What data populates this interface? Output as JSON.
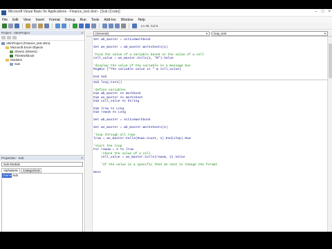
{
  "window": {
    "title": "Microsoft Visual Basic for Applications - Finance_test.xlsm - [Sub (Code)]",
    "controls": [
      "–",
      "□",
      "×"
    ]
  },
  "menu": [
    "File",
    "Edit",
    "View",
    "Insert",
    "Format",
    "Debug",
    "Run",
    "Tools",
    "Add-Ins",
    "Window",
    "Help"
  ],
  "toolbar": {
    "position": "Ln 40, Col 5"
  },
  "project_pane": {
    "title": "Project - VBAProject",
    "close": "×",
    "tree": [
      {
        "label": "VBAProject (Finance_test.xlsm)",
        "indent": 0,
        "kind": "proj"
      },
      {
        "label": "Microsoft Excel Objects",
        "indent": 1,
        "kind": "folder"
      },
      {
        "label": "Sheet1 (Sheet1)",
        "indent": 2,
        "kind": "sheet"
      },
      {
        "label": "ThisWorkbook",
        "indent": 2,
        "kind": "wb"
      },
      {
        "label": "Modules",
        "indent": 1,
        "kind": "folder"
      },
      {
        "label": "Sub",
        "indent": 2,
        "kind": "mod"
      }
    ]
  },
  "properties_pane": {
    "title": "Properties - Sub",
    "close": "×",
    "selected": "Sub Module",
    "tabs": [
      "Alphabetic",
      "Categorized"
    ],
    "rows": [
      {
        "key": "(Name)",
        "value": "Sub"
      }
    ]
  },
  "code_window": {
    "object_select": "(General)",
    "proc_select": "loop_test",
    "lines": [
      {
        "text": "Set wb_master = ActiveWorkbook",
        "kind": "code"
      },
      {
        "text": "",
        "kind": "blank"
      },
      {
        "text": "Set ws_master = wb_master.Worksheets(1)",
        "kind": "code"
      },
      {
        "text": "",
        "kind": "blank"
      },
      {
        "text": "'Find the value of a variable based on the value of a cell",
        "kind": "comment"
      },
      {
        "text": "cell_value = ws_master.Cells(1, \"B\").Value",
        "kind": "code"
      },
      {
        "text": "",
        "kind": "blank"
      },
      {
        "text": "'display the value of the variable in a message box",
        "kind": "comment"
      },
      {
        "text": "MsgBox (\"The variable value is \" & cell_value)",
        "kind": "code"
      },
      {
        "text": "",
        "kind": "blank"
      },
      {
        "text": "End Sub",
        "kind": "code"
      },
      {
        "text": "",
        "kind": "sep"
      },
      {
        "text": "Sub loop_test()",
        "kind": "code"
      },
      {
        "text": "",
        "kind": "blank"
      },
      {
        "text": "'define variables",
        "kind": "comment"
      },
      {
        "text": "Dim wb_master As Workbook",
        "kind": "code"
      },
      {
        "text": "Dim ws_master As Worksheet",
        "kind": "code"
      },
      {
        "text": "Dim cell_value As String",
        "kind": "code"
      },
      {
        "text": "",
        "kind": "blank"
      },
      {
        "text": "Dim lrow As Long",
        "kind": "code"
      },
      {
        "text": "Dim rowum As Long",
        "kind": "code"
      },
      {
        "text": "",
        "kind": "blank"
      },
      {
        "text": "Set wb_master = ActiveWorkbook",
        "kind": "code"
      },
      {
        "text": "",
        "kind": "blank"
      },
      {
        "text": "Set ws_master = wb_master.Worksheets(1)",
        "kind": "code"
      },
      {
        "text": "",
        "kind": "blank"
      },
      {
        "text": "'loop through all rows",
        "kind": "comment"
      },
      {
        "text": "lrow = ws_master.Cells(Rows.Count, 1).End(xlUp).Row",
        "kind": "code"
      },
      {
        "text": "",
        "kind": "blank"
      },
      {
        "text": "'start the loop",
        "kind": "comment"
      },
      {
        "text": "For rowum = 2 To lrow",
        "kind": "code"
      },
      {
        "text": "    'check the value of a cell",
        "kind": "comment"
      },
      {
        "text": "    cell_value = ws_master.Cells(rowum, 2).Value",
        "kind": "code"
      },
      {
        "text": "",
        "kind": "blank"
      },
      {
        "text": "    'If the value is a specific then do next to change the format",
        "kind": "comment"
      },
      {
        "text": "",
        "kind": "blank"
      },
      {
        "text": "Next",
        "kind": "code"
      }
    ]
  }
}
